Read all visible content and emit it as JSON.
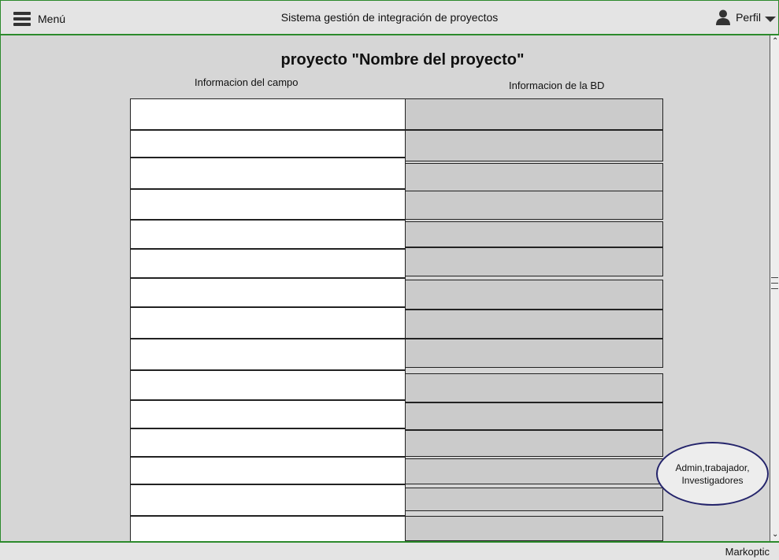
{
  "header": {
    "menu_label": "Menú",
    "title": "Sistema gestión de integración de proyectos",
    "profile_label": "Perfil"
  },
  "main": {
    "page_title": "proyecto \"Nombre del proyecto\"",
    "field_column_header": "Informacion del campo",
    "db_column_header": "Informacion de la BD",
    "field_rows": 15,
    "db_rows": 15
  },
  "roles_badge": {
    "line1": "Admin,trabajador,",
    "line2": "Investigadores"
  },
  "footer": {
    "label": "Markoptic"
  },
  "icons": [
    "hamburger-icon",
    "user-icon",
    "caret-down-icon",
    "scroll-up-icon",
    "scroll-down-icon"
  ]
}
